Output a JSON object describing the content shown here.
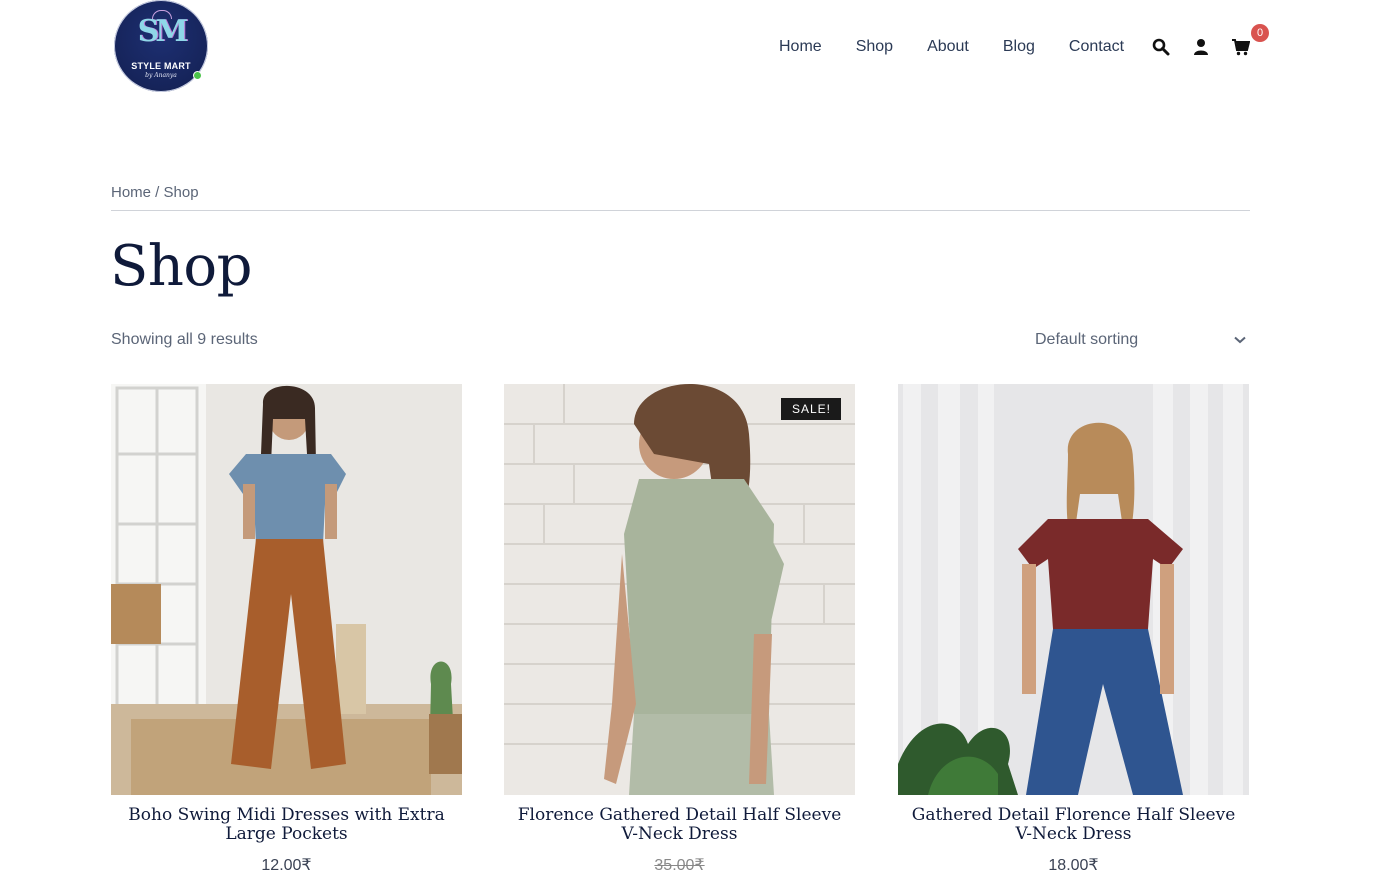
{
  "header": {
    "logo_mono": "SM",
    "logo_brand": "STYLE MART",
    "logo_tagline": "by Ananya",
    "nav": [
      "Home",
      "Shop",
      "About",
      "Blog",
      "Contact"
    ],
    "cart_count": "0",
    "icons": [
      "search-icon",
      "user-icon",
      "cart-icon"
    ]
  },
  "breadcrumb": {
    "home": "Home",
    "sep": " / ",
    "current": "Shop"
  },
  "page_title": "Shop",
  "result_count": "Showing all 9 results",
  "sorting": {
    "selected": "Default sorting"
  },
  "products": [
    {
      "title": "Boho Swing Midi Dresses with Extra Large Pockets",
      "price": "12.00₹",
      "sale": ""
    },
    {
      "title": "Florence Gathered Detail Half Sleeve V-Neck Dress",
      "price": "35.00₹",
      "sale": "SALE!"
    },
    {
      "title": "Gathered Detail Florence Half Sleeve V-Neck Dress",
      "price": "18.00₹",
      "sale": ""
    }
  ],
  "colors": {
    "accent_badge": "#d9534f",
    "title": "#0f1a3a",
    "nav": "#2b3a55"
  }
}
